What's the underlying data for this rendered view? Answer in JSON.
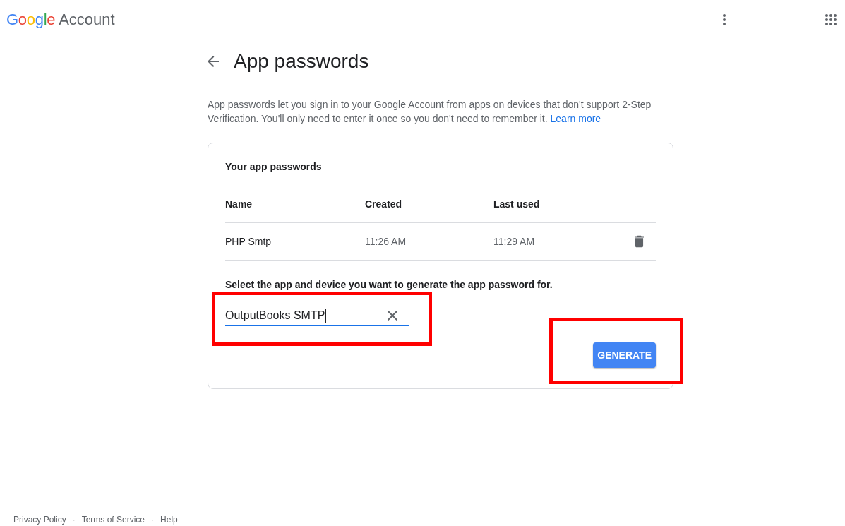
{
  "header": {
    "logo": "Google",
    "product": "Account"
  },
  "page": {
    "title": "App passwords"
  },
  "intro": {
    "text": "App passwords let you sign in to your Google Account from apps on devices that don't support 2-Step Verification. You'll only need to enter it once so you don't need to remember it.",
    "link": "Learn more"
  },
  "card": {
    "title": "Your app passwords",
    "table": {
      "columns": [
        "Name",
        "Created",
        "Last used"
      ],
      "rows": [
        {
          "cells": [
            "PHP Smtp",
            "11:26 AM",
            "11:29 AM"
          ]
        }
      ]
    },
    "prompt": "Select the app and device you want to generate the app password for.",
    "app_field": {
      "value": "OutputBooks SMTP",
      "focused": true,
      "highlighted": true
    },
    "generate_button": {
      "label": "GENERATE",
      "highlighted": true
    }
  },
  "footer": {
    "items": [
      {
        "kind": "link",
        "text": "Privacy Policy"
      },
      {
        "kind": "separator",
        "text": "·"
      },
      {
        "kind": "link",
        "text": "Terms of Service"
      },
      {
        "kind": "separator",
        "text": "·"
      },
      {
        "kind": "link",
        "text": "Help"
      }
    ]
  }
}
